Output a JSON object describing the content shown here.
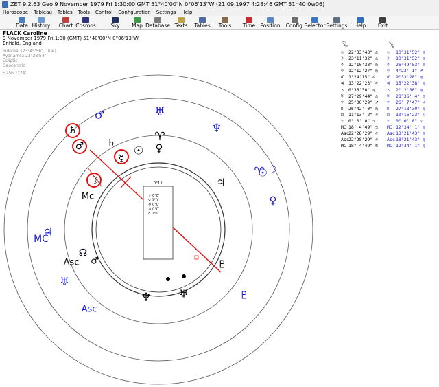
{
  "window": {
    "title": "ZET 9.2.63 Geo    9 November 1979  Fri    1:30:00 GMT 51°40'00\"N  0°06'13\"W  (21.09.1997  4:28:46 GMT 51n40 0w06)"
  },
  "menu": [
    "Horoscope",
    "Tableau",
    "Tables",
    "Tools",
    "Control",
    "Configuration",
    "Settings",
    "Help"
  ],
  "toolbar": [
    {
      "label": "Data",
      "icon": "data-icon",
      "color": "#4a7fc0"
    },
    {
      "label": "History",
      "icon": "history-icon",
      "color": "#6a9ad0"
    },
    {
      "label": "Chart",
      "icon": "chart-icon",
      "color": "#c04040"
    },
    {
      "label": "Cosmos",
      "icon": "cosmos-icon",
      "color": "#303080"
    },
    {
      "label": "Sky",
      "icon": "sky-icon",
      "color": "#203060"
    },
    {
      "label": "Map",
      "icon": "map-icon",
      "color": "#3a9a4a"
    },
    {
      "label": "Database",
      "icon": "database-icon",
      "color": "#7a7a7a"
    },
    {
      "label": "Texts",
      "icon": "texts-icon",
      "color": "#c0a050"
    },
    {
      "label": "Tables",
      "icon": "tables-icon",
      "color": "#4a6aa0"
    },
    {
      "label": "Tools",
      "icon": "tools-icon",
      "color": "#8a6a4a"
    },
    {
      "label": "Time",
      "icon": "time-icon",
      "color": "#c03030"
    },
    {
      "label": "Position",
      "icon": "position-icon",
      "color": "#5a8ac0"
    },
    {
      "label": "Config.",
      "icon": "config-icon",
      "color": "#707070"
    },
    {
      "label": "Selector",
      "icon": "selector-icon",
      "color": "#3a7ac0"
    },
    {
      "label": "Settings",
      "icon": "settings-icon",
      "color": "#607080"
    },
    {
      "label": "Help",
      "icon": "help-icon",
      "color": "#3070c0"
    },
    {
      "label": "Exit",
      "icon": "exit-icon",
      "color": "#404040"
    }
  ],
  "person": {
    "name": "FLACK Caroline",
    "line1": "9 November 1979  Fri   1:30 (GMT) 51°40'00\"N  0°06'13\"W",
    "line2": "Enfield, England",
    "zodiac": "Sidereal (23°45'56\", True)",
    "ayanamsa": "Ayanamsa 23°28'54\"",
    "ecliptic": "Ecliptic",
    "mode": "Geocentric",
    "extra": "H256   1°24'"
  },
  "table": {
    "col1_header": "Nat.",
    "col2_header": "Geo",
    "rows": [
      {
        "s1": "☉",
        "v1": "22°33'43\" ♎",
        "s2": "☉",
        "v2": "10°31'52\" ♍"
      },
      {
        "s1": "☽",
        "v1": "23°11'32\" ♎",
        "s2": "☽",
        "v2": "10°31'52\" ♍"
      },
      {
        "s1": "☿",
        "v1": "12°10'33\" ♍",
        "s2": "☿",
        "v2": "26°49'53\" ♎"
      },
      {
        "s1": "♀",
        "v1": "12°12'27\" ♍",
        "s2": "♀",
        "v2": "4°23' 1\" ♐"
      },
      {
        "s1": "♂",
        "v1": "1°24'15\" ♌",
        "s2": "♂",
        "v2": "9°33'28\" ♍"
      },
      {
        "s1": "♃",
        "v1": "13°22'23\" ♌",
        "s2": "♃",
        "v2": "15°22'38\" ♍"
      },
      {
        "s1": "♄",
        "v1": "0°35'30\" ♍",
        "s2": "♄",
        "v2": "2° 2'50\" ♍"
      },
      {
        "s1": "♅",
        "v1": "27°29'44\" ♎",
        "s2": "♅",
        "v2": "28°36' 4\" ♎"
      },
      {
        "s1": "♆",
        "v1": "25°30'29\" ♐",
        "s2": "♆",
        "v2": "26° 7'47\" ♐"
      },
      {
        "s1": "♇",
        "v1": "26°42' 0\" ♍",
        "s2": "♇",
        "v2": "27°18'30\" ♍"
      },
      {
        "s1": "☊",
        "v1": "11°13' 2\" ♌",
        "s2": "☊",
        "v2": "10°16'23\" ♌"
      },
      {
        "s1": "♈",
        "v1": "0° 0' 0\" ♈",
        "s2": "♈",
        "v2": "0° 0' 0\" ♈"
      },
      {
        "s1": "MC",
        "v1": "18° 4'49\" ♋",
        "s2": "MC",
        "v2": "12°34' 1\" ♍"
      },
      {
        "s1": "Asc",
        "v1": "22°28'29\" ♌",
        "s2": "Asc",
        "v2": "18°21'43\" ♍"
      },
      {
        "s1": "Asc",
        "v1": "22°28'29\" ♌",
        "s2": "Asc",
        "v2": "18°21'43\" ♍"
      },
      {
        "s1": "MC",
        "v1": "18° 4'49\" ♋",
        "s2": "MC",
        "v2": "12°34' 1\" ♍"
      }
    ]
  },
  "chart": {
    "inner_box_title": "0°11'",
    "inner_box_lines": [
      "♆  0°0'",
      "♀  0°0'",
      "♅  0°0'",
      "♃  0°0'",
      "☿  0°0'"
    ],
    "colors": {
      "black": "#000000",
      "blue": "#1a1ad0",
      "red": "#e01010",
      "grey": "#777777"
    },
    "outer_glyphs": [
      {
        "g": "♅",
        "color": "#1a1ad0",
        "kind": "outer-uranus"
      },
      {
        "g": "♈",
        "color": "#1a1ad0",
        "kind": "outer-aries"
      },
      {
        "g": "♆",
        "color": "#1a1ad0",
        "kind": "outer-neptune"
      },
      {
        "g": "☉",
        "color": "#1a1ad0",
        "kind": "outer-sun"
      },
      {
        "g": "☽",
        "color": "#1a1ad0",
        "kind": "outer-moon"
      },
      {
        "g": "♀",
        "color": "#1a1ad0",
        "kind": "outer-venus"
      },
      {
        "g": "♇",
        "color": "#1a1ad0",
        "kind": "outer-pluto"
      },
      {
        "g": "♂",
        "color": "#1a1ad0",
        "kind": "outer-mars"
      },
      {
        "g": "MC",
        "color": "#1a1ad0",
        "kind": "outer-mc"
      },
      {
        "g": "♃",
        "color": "#1a1ad0",
        "kind": "outer-jupiter"
      },
      {
        "g": "♅",
        "color": "#1a1ad0",
        "kind": "outer-uranus-2"
      },
      {
        "g": "Asc",
        "color": "#1a1ad0",
        "kind": "outer-asc"
      },
      {
        "g": "☊",
        "color": "#1a1ad0",
        "kind": "outer-node"
      },
      {
        "g": "♆",
        "color": "#000000",
        "kind": "inner-neptune"
      },
      {
        "g": "♅",
        "color": "#000000",
        "kind": "inner-uranus"
      },
      {
        "g": "♇",
        "color": "#000000",
        "kind": "inner-pluto"
      },
      {
        "g": "♃",
        "color": "#000000",
        "kind": "inner-jupiter"
      },
      {
        "g": "♀",
        "color": "#000000",
        "kind": "inner-venus"
      },
      {
        "g": "♈",
        "color": "#000000",
        "kind": "inner-aries"
      },
      {
        "g": "☉",
        "color": "#000000",
        "kind": "inner-sun"
      },
      {
        "g": "☿",
        "color": "#000000",
        "kind": "inner-mercury"
      },
      {
        "g": "♄",
        "color": "#000000",
        "kind": "inner-saturn"
      },
      {
        "g": "♄",
        "color": "#000000",
        "kind": "ring-saturn"
      },
      {
        "g": "♂",
        "color": "#000000",
        "kind": "ring-mars"
      },
      {
        "g": "☽",
        "color": "#000000",
        "kind": "ring-moon"
      },
      {
        "g": "Mc",
        "color": "#000000",
        "kind": "inner-mc"
      },
      {
        "g": "☊",
        "color": "#000000",
        "kind": "inner-node"
      },
      {
        "g": "Asc",
        "color": "#000000",
        "kind": "inner-asc"
      },
      {
        "g": "♂",
        "color": "#000000",
        "kind": "inner-mars"
      }
    ]
  }
}
